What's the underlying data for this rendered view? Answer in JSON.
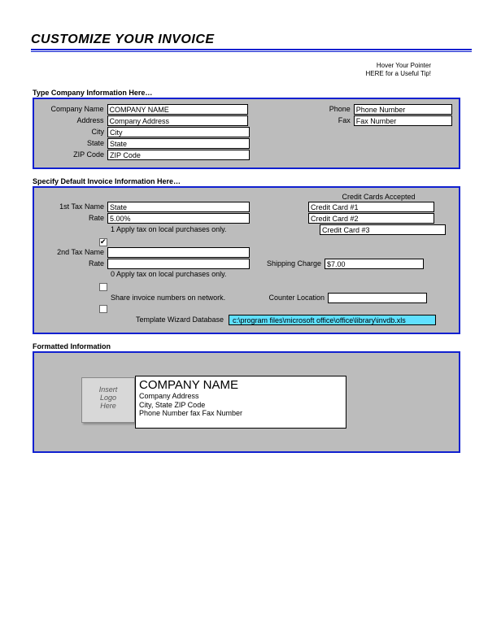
{
  "title": "CUSTOMIZE YOUR INVOICE",
  "hint": {
    "l1": "Hover Your Pointer",
    "l2": "HERE for a Useful Tip!"
  },
  "sec1": {
    "heading": "Type Company Information Here…",
    "companyName": {
      "label": "Company Name",
      "value": "COMPANY NAME"
    },
    "address": {
      "label": "Address",
      "value": "Company Address"
    },
    "city": {
      "label": "City",
      "value": "City"
    },
    "state": {
      "label": "State",
      "value": "State"
    },
    "zip": {
      "label": "ZIP Code",
      "value": "ZIP Code"
    },
    "phone": {
      "label": "Phone",
      "value": "Phone Number"
    },
    "fax": {
      "label": "Fax",
      "value": "Fax Number"
    }
  },
  "sec2": {
    "heading": "Specify Default Invoice Information Here…",
    "tax1": {
      "nameLabel": "1st Tax Name",
      "name": "State",
      "rateLabel": "Rate",
      "rate": "5.00%",
      "note": "1 Apply tax on local purchases only."
    },
    "tax2": {
      "nameLabel": "2nd Tax Name",
      "name": "",
      "rateLabel": "Rate",
      "rate": "",
      "note": "0 Apply tax on local purchases only."
    },
    "ccHead": "Credit Cards Accepted",
    "cc": [
      "Credit Card #1",
      "Credit Card #2",
      "Credit Card #3"
    ],
    "shipping": {
      "label": "Shipping Charge",
      "value": "$7.00"
    },
    "share": {
      "label": "Share invoice numbers on network."
    },
    "counter": {
      "label": "Counter Location",
      "value": ""
    },
    "db": {
      "label": "Template Wizard Database",
      "path": "c:\\program files\\microsoft office\\office\\library\\invdb.xls"
    }
  },
  "sec3": {
    "heading": "Formatted Information",
    "logoText": "Insert\nLogo\nHere",
    "name": "COMPANY NAME",
    "addr": "Company Address",
    "cityline": "City, State  ZIP Code",
    "phoneline": "Phone Number fax Fax Number"
  }
}
